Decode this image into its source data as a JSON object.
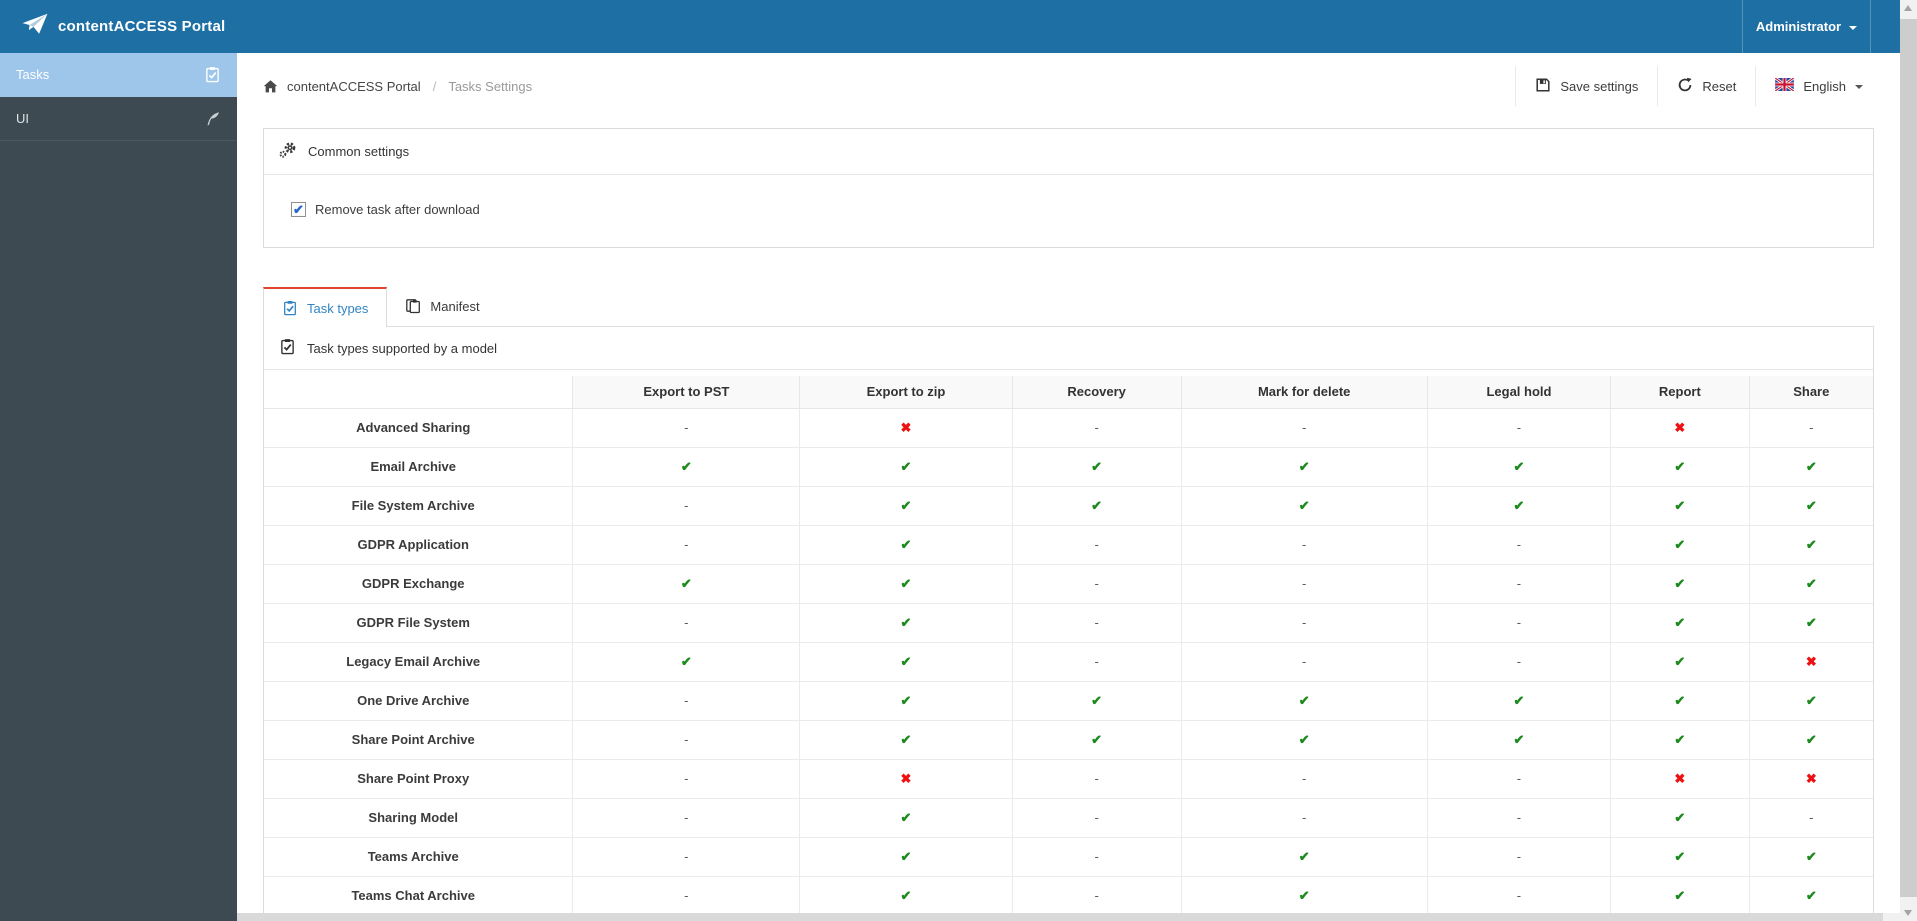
{
  "colors": {
    "header_blue": "#1e6fa4",
    "sidebar_dark": "#3e4a52",
    "sidebar_selected_blue": "#9dc6ea",
    "tab_accent_red": "#e2452d",
    "active_tab_text_blue": "#3084c4",
    "check_green": "#1d8a1d",
    "cross_red": "#ee1111",
    "checkbox_check_blue": "#2667c9"
  },
  "header": {
    "app_title": "contentACCESS Portal",
    "user_menu_label": "Administrator"
  },
  "sidebar": {
    "items": [
      {
        "label": "Tasks",
        "icon": "clipboard-check-icon",
        "active": true
      },
      {
        "label": "UI",
        "icon": "feather-icon",
        "active": false
      }
    ]
  },
  "breadcrumb": {
    "root": "contentACCESS Portal",
    "separator": "/",
    "current": "Tasks Settings"
  },
  "toolbar": {
    "save_label": "Save settings",
    "reset_label": "Reset",
    "language_label": "English"
  },
  "common_settings": {
    "title": "Common settings",
    "checkbox_label": "Remove task after download",
    "checkbox_checked": true,
    "check_glyph": "✔"
  },
  "tabs": [
    {
      "label": "Task types",
      "active": true
    },
    {
      "label": "Manifest",
      "active": false
    }
  ],
  "table": {
    "section_title": "Task types supported by a model",
    "columns": [
      "",
      "Export to PST",
      "Export to zip",
      "Recovery",
      "Mark for delete",
      "Legal hold",
      "Report",
      "Share"
    ],
    "symbols": {
      "check": "✔",
      "cross": "✖",
      "dash": "-"
    },
    "rows": [
      {
        "label": "Advanced Sharing",
        "cells": [
          "dash",
          "cross",
          "dash",
          "dash",
          "dash",
          "cross",
          "dash"
        ]
      },
      {
        "label": "Email Archive",
        "cells": [
          "check",
          "check",
          "check",
          "check",
          "check",
          "check",
          "check"
        ]
      },
      {
        "label": "File System Archive",
        "cells": [
          "dash",
          "check",
          "check",
          "check",
          "check",
          "check",
          "check"
        ]
      },
      {
        "label": "GDPR Application",
        "cells": [
          "dash",
          "check",
          "dash",
          "dash",
          "dash",
          "check",
          "check"
        ]
      },
      {
        "label": "GDPR Exchange",
        "cells": [
          "check",
          "check",
          "dash",
          "dash",
          "dash",
          "check",
          "check"
        ]
      },
      {
        "label": "GDPR File System",
        "cells": [
          "dash",
          "check",
          "dash",
          "dash",
          "dash",
          "check",
          "check"
        ]
      },
      {
        "label": "Legacy Email Archive",
        "cells": [
          "check",
          "check",
          "dash",
          "dash",
          "dash",
          "check",
          "cross"
        ]
      },
      {
        "label": "One Drive Archive",
        "cells": [
          "dash",
          "check",
          "check",
          "check",
          "check",
          "check",
          "check"
        ]
      },
      {
        "label": "Share Point Archive",
        "cells": [
          "dash",
          "check",
          "check",
          "check",
          "check",
          "check",
          "check"
        ]
      },
      {
        "label": "Share Point Proxy",
        "cells": [
          "dash",
          "cross",
          "dash",
          "dash",
          "dash",
          "cross",
          "cross"
        ]
      },
      {
        "label": "Sharing Model",
        "cells": [
          "dash",
          "check",
          "dash",
          "dash",
          "dash",
          "check",
          "dash"
        ]
      },
      {
        "label": "Teams Archive",
        "cells": [
          "dash",
          "check",
          "dash",
          "check",
          "dash",
          "check",
          "check"
        ]
      },
      {
        "label": "Teams Chat Archive",
        "cells": [
          "dash",
          "check",
          "dash",
          "check",
          "dash",
          "check",
          "check"
        ]
      }
    ]
  }
}
